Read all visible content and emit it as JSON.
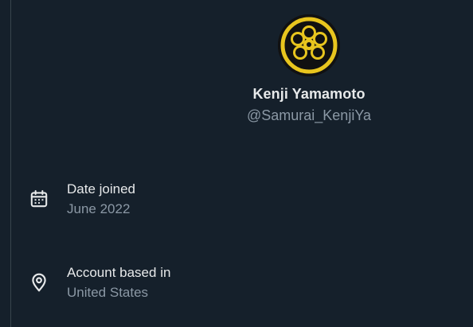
{
  "profile": {
    "display_name": "Kenji Yamamoto",
    "handle": "@Samurai_KenjiYa",
    "avatar_icon": "family-crest-avatar",
    "avatar_color": "#e8c51e"
  },
  "details": {
    "joined": {
      "icon": "calendar-icon",
      "label": "Date joined",
      "value": "June 2022"
    },
    "location": {
      "icon": "location-pin-icon",
      "label": "Account based in",
      "value": "United States"
    }
  },
  "colors": {
    "background": "#15202b",
    "primary_text": "#e7e9ea",
    "secondary_text": "#8b98a5",
    "divider": "#38444d"
  }
}
